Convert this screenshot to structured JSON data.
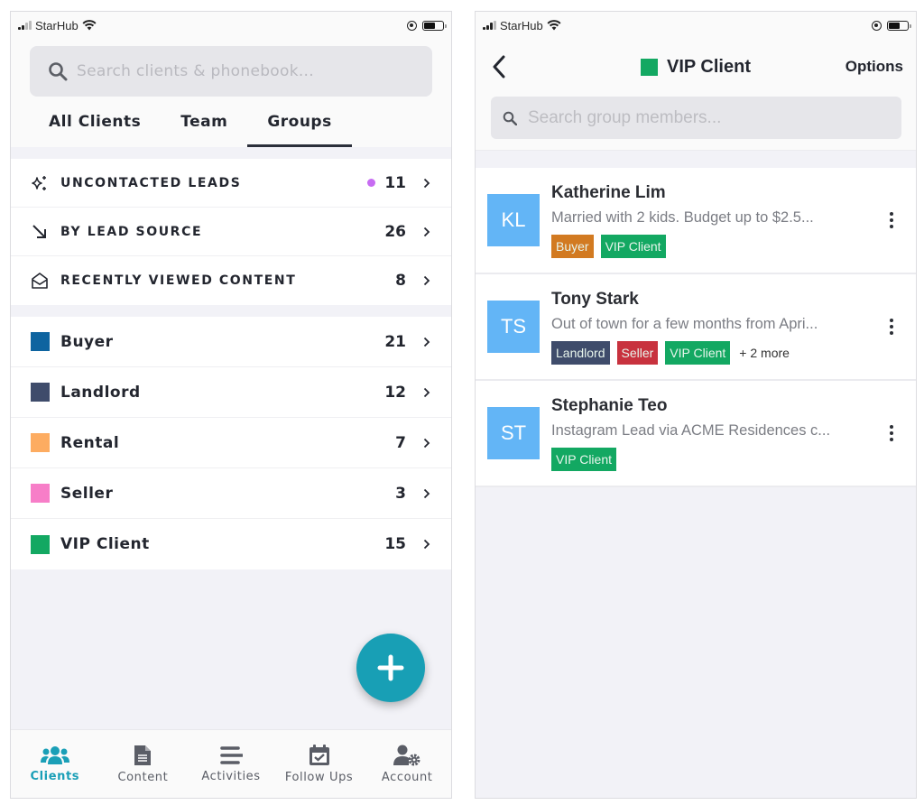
{
  "status_bar": {
    "carrier": "StarHub"
  },
  "left": {
    "search": {
      "placeholder": "Search clients & phonebook..."
    },
    "tabs": [
      {
        "label": "All Clients",
        "active": false
      },
      {
        "label": "Team",
        "active": false
      },
      {
        "label": "Groups",
        "active": true
      }
    ],
    "smart_lists": [
      {
        "icon": "sparkle-icon",
        "label": "UNCONTACTED LEADS",
        "count": "11",
        "dot_color": "#c76cf2"
      },
      {
        "icon": "arrow-down-right-icon",
        "label": "BY LEAD SOURCE",
        "count": "26"
      },
      {
        "icon": "envelope-open-icon",
        "label": "RECENTLY VIEWED CONTENT",
        "count": "8"
      }
    ],
    "groups": [
      {
        "label": "Buyer",
        "count": "21",
        "color": "#0e64a0"
      },
      {
        "label": "Landlord",
        "count": "12",
        "color": "#3f4c6b"
      },
      {
        "label": "Rental",
        "count": "7",
        "color": "#fdac61"
      },
      {
        "label": "Seller",
        "count": "3",
        "color": "#f77ec8"
      },
      {
        "label": "VIP Client",
        "count": "15",
        "color": "#13a862"
      }
    ],
    "fab": {
      "icon": "plus-icon",
      "color": "#189fb5"
    },
    "bottom_nav": [
      {
        "label": "Clients",
        "icon": "users-icon",
        "active": true
      },
      {
        "label": "Content",
        "icon": "document-icon",
        "active": false
      },
      {
        "label": "Activities",
        "icon": "list-icon",
        "active": false
      },
      {
        "label": "Follow Ups",
        "icon": "calendar-check-icon",
        "active": false
      },
      {
        "label": "Account",
        "icon": "user-gear-icon",
        "active": false
      }
    ]
  },
  "right": {
    "header": {
      "title": "VIP Client",
      "title_color": "#13a862",
      "options_label": "Options"
    },
    "search": {
      "placeholder": "Search group members..."
    },
    "members": [
      {
        "initials": "KL",
        "name": "Katherine Lim",
        "note": "Married with 2 kids. Budget up to $2.5...",
        "tags": [
          {
            "label": "Buyer",
            "color": "#d27a21"
          },
          {
            "label": "VIP Client",
            "color": "#13a862"
          }
        ],
        "more": ""
      },
      {
        "initials": "TS",
        "name": "Tony Stark",
        "note": "Out of town for a few months from Apri...",
        "tags": [
          {
            "label": "Landlord",
            "color": "#3f4c6b"
          },
          {
            "label": "Seller",
            "color": "#c8323e"
          },
          {
            "label": "VIP Client",
            "color": "#13a862"
          }
        ],
        "more": "+ 2 more"
      },
      {
        "initials": "ST",
        "name": "Stephanie Teo",
        "note": "Instagram Lead via ACME Residences c...",
        "tags": [
          {
            "label": "VIP Client",
            "color": "#13a862"
          }
        ],
        "more": ""
      }
    ]
  }
}
